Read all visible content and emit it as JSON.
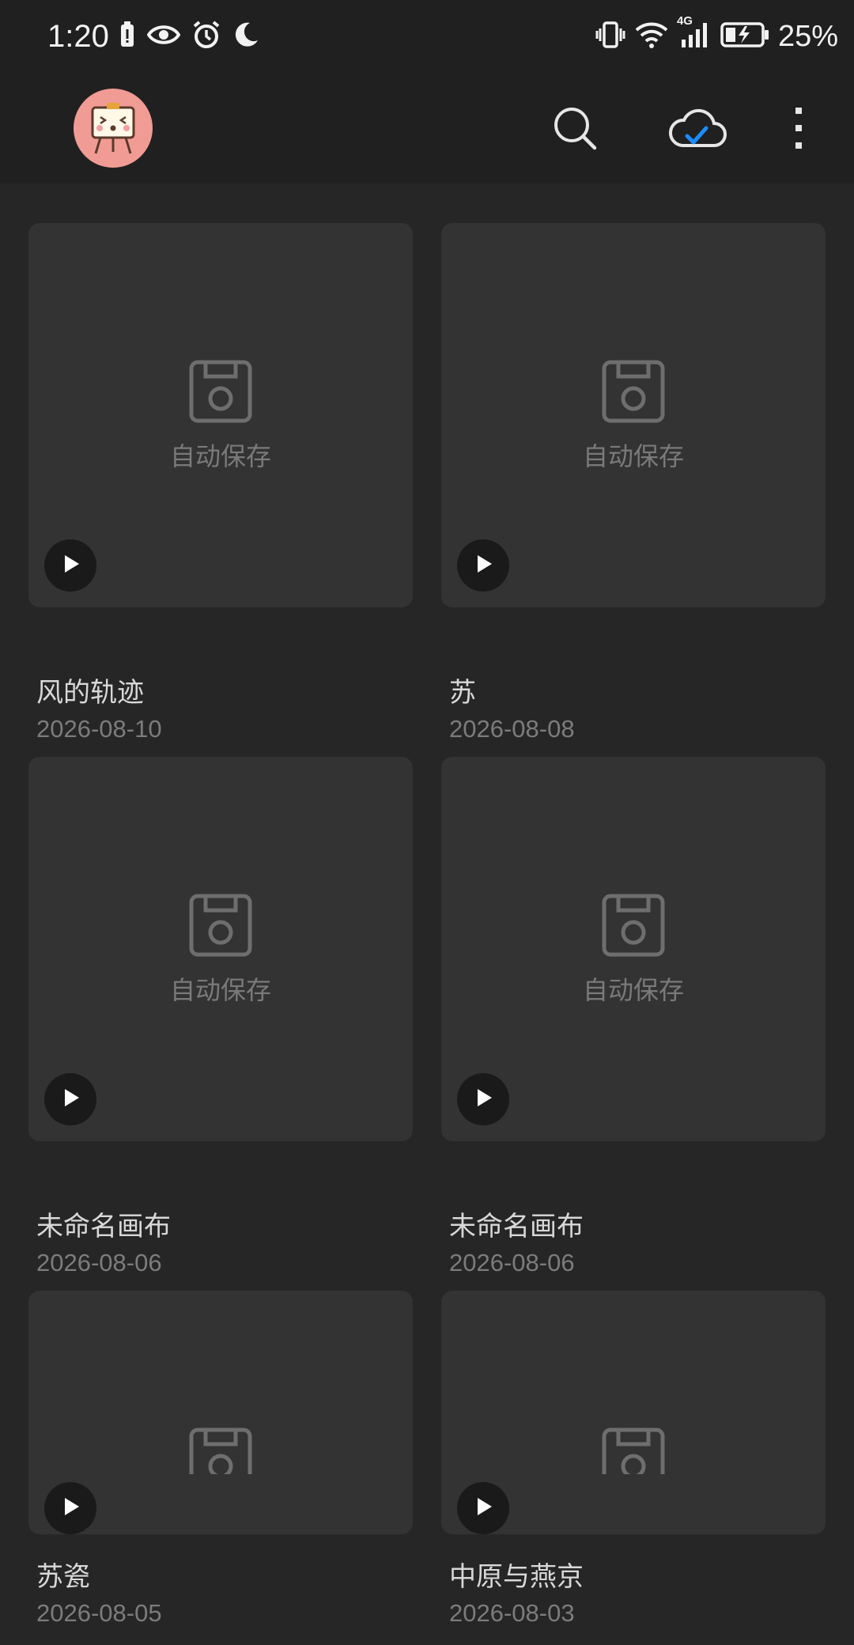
{
  "status_bar": {
    "time": "1:20",
    "battery_percent": "25%",
    "network": "4G",
    "icons": [
      "battery-alert-icon",
      "eye-icon",
      "alarm-icon",
      "moon-icon",
      "vibrate-icon",
      "wifi-icon",
      "signal-icon",
      "battery-icon"
    ]
  },
  "top_bar": {
    "icons": [
      "avatar-icon",
      "search-icon",
      "cloud-check-icon",
      "more-vertical-icon"
    ],
    "cloud_check_color": "#1a8cff"
  },
  "projects": [
    {
      "title": "风的轨迹",
      "date": "2026-08-10",
      "thumbnail_label": "自动保存"
    },
    {
      "title": "苏",
      "date": "2026-08-08",
      "thumbnail_label": "自动保存"
    },
    {
      "title": "未命名画布",
      "date": "2026-08-06",
      "thumbnail_label": "自动保存"
    },
    {
      "title": "未命名画布",
      "date": "2026-08-06",
      "thumbnail_label": "自动保存"
    },
    {
      "title": "苏瓷",
      "date": "2026-08-05",
      "thumbnail_label": ""
    },
    {
      "title": "中原与燕京",
      "date": "2026-08-03",
      "thumbnail_label": ""
    }
  ]
}
